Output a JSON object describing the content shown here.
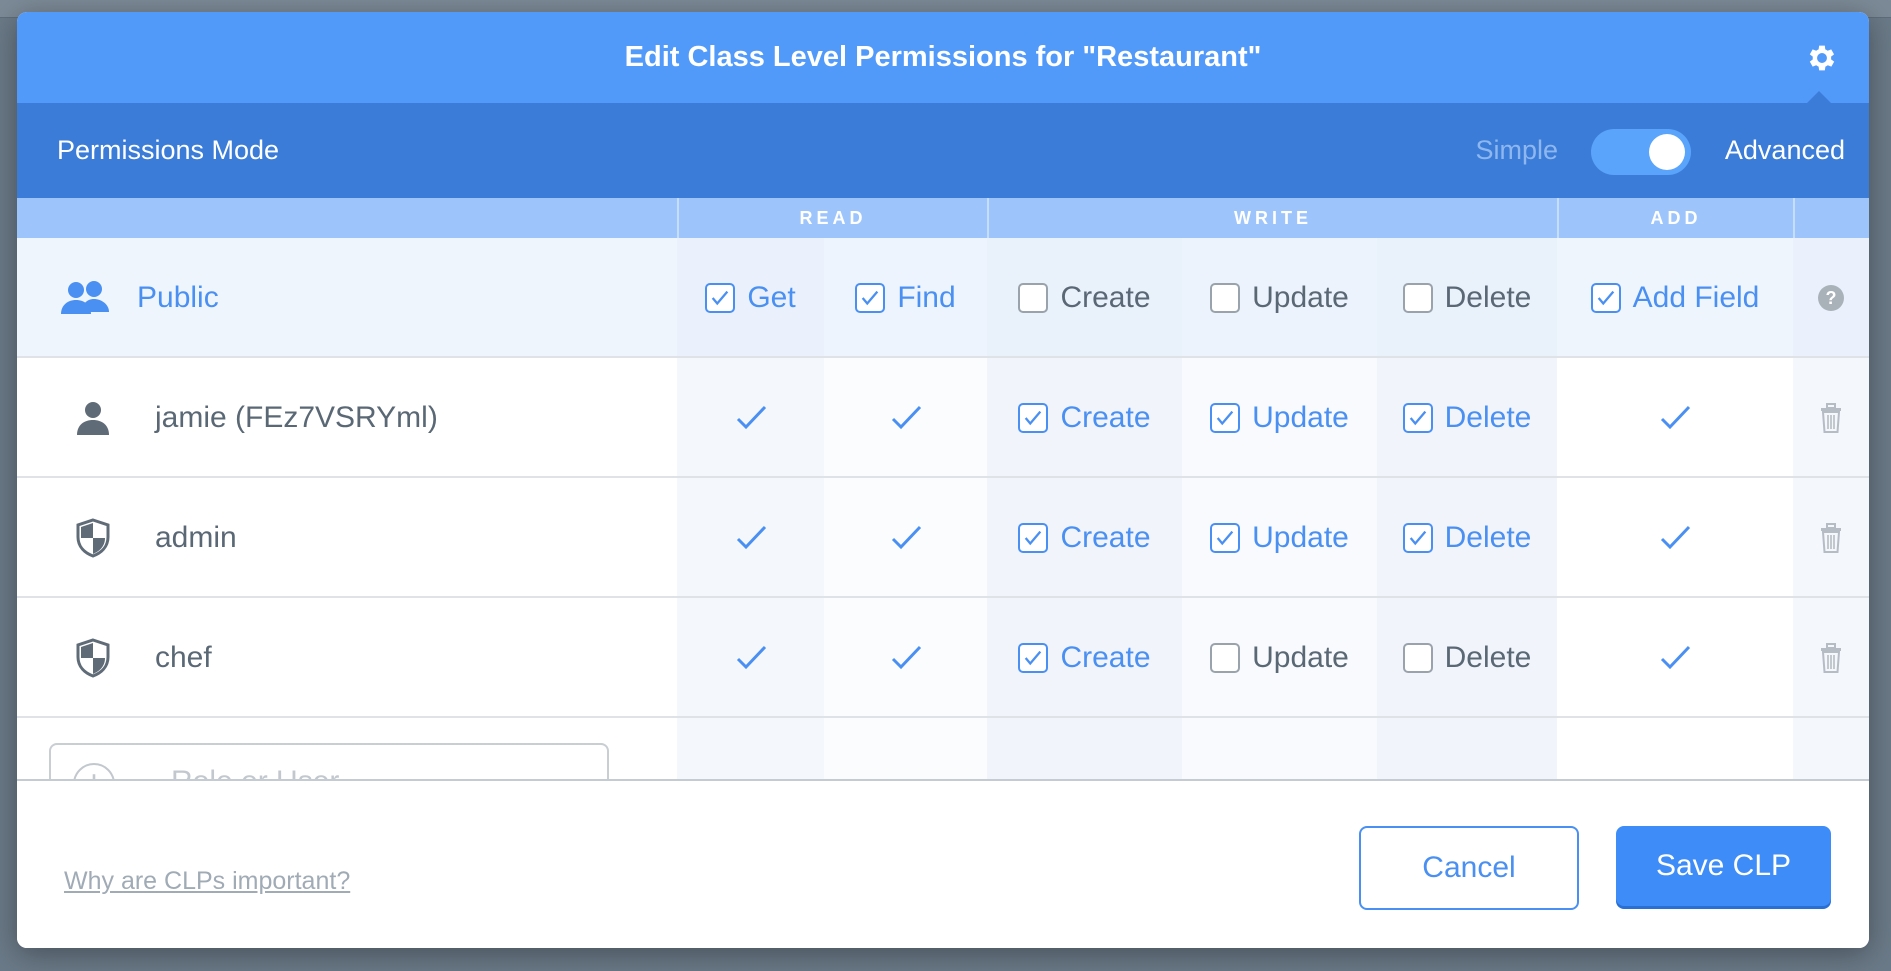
{
  "modal": {
    "title": "Edit Class Level Permissions for \"Restaurant\"",
    "mode_label": "Permissions Mode",
    "mode_simple": "Simple",
    "mode_advanced": "Advanced",
    "mode_selected": "Advanced"
  },
  "groups": [
    "READ",
    "WRITE",
    "ADD"
  ],
  "public": {
    "label": "Public",
    "perms": [
      {
        "label": "Get",
        "checked": true
      },
      {
        "label": "Find",
        "checked": true
      },
      {
        "label": "Create",
        "checked": false
      },
      {
        "label": "Update",
        "checked": false
      },
      {
        "label": "Delete",
        "checked": false
      },
      {
        "label": "Add Field",
        "checked": true
      }
    ],
    "help": "?"
  },
  "rows": [
    {
      "name": "jamie (FEz7VSRYml)",
      "icon": "user-icon",
      "get": true,
      "find": true,
      "write": [
        {
          "label": "Create",
          "checked": true
        },
        {
          "label": "Update",
          "checked": true
        },
        {
          "label": "Delete",
          "checked": true
        }
      ],
      "add": true
    },
    {
      "name": "admin",
      "icon": "role-shield-icon",
      "get": true,
      "find": true,
      "write": [
        {
          "label": "Create",
          "checked": true
        },
        {
          "label": "Update",
          "checked": true
        },
        {
          "label": "Delete",
          "checked": true
        }
      ],
      "add": true
    },
    {
      "name": "chef",
      "icon": "role-shield-icon",
      "get": true,
      "find": true,
      "write": [
        {
          "label": "Create",
          "checked": true
        },
        {
          "label": "Update",
          "checked": false
        },
        {
          "label": "Delete",
          "checked": false
        }
      ],
      "add": true
    }
  ],
  "adder": {
    "placeholder": "Role or User"
  },
  "footer": {
    "help_link": "Why are CLPs important?",
    "cancel": "Cancel",
    "save": "Save CLP"
  },
  "colors": {
    "header": "#529afa",
    "modebar": "#3a7cd8",
    "accent": "#4a90f2"
  }
}
